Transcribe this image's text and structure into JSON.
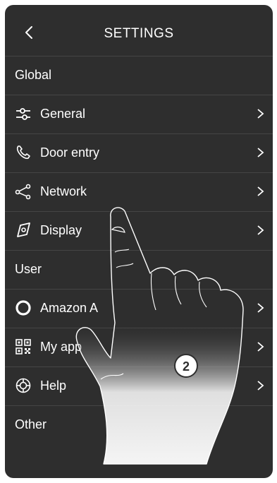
{
  "header": {
    "title": "SETTINGS"
  },
  "sections": {
    "global": "Global",
    "user": "User",
    "other": "Other"
  },
  "rows": {
    "general": "General",
    "door_entry": "Door entry",
    "network": "Network",
    "display": "Display",
    "amazon": "Amazon A",
    "my_app": "My app",
    "help": "Help"
  },
  "overlay": {
    "step_number": "2"
  },
  "icons": [
    "back-arrow-icon",
    "sliders-icon",
    "phone-icon",
    "share-network-icon",
    "display-icon",
    "ring-icon",
    "qr-code-icon",
    "lifebuoy-icon",
    "chevron-right-icon"
  ],
  "colors": {
    "background": "#2e2e2e",
    "divider": "#454545",
    "text": "#ffffff"
  }
}
